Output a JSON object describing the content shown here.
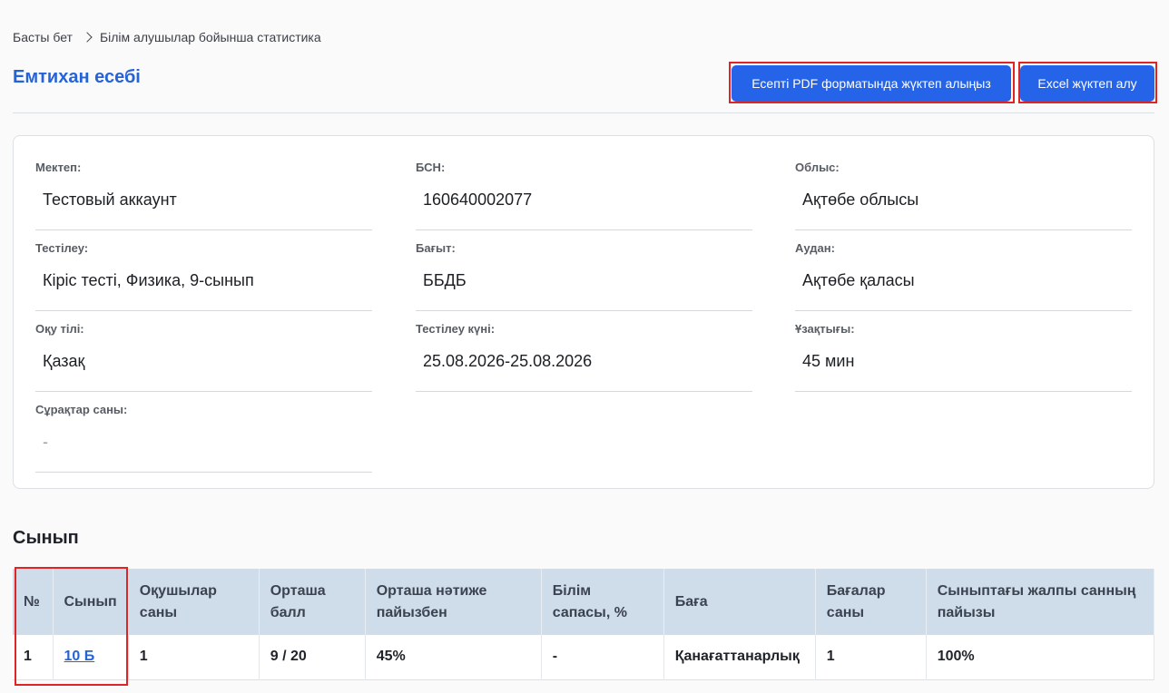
{
  "breadcrumb": {
    "home": "Басты бет",
    "current": "Білім алушылар бойынша статистика"
  },
  "page_title": "Емтихан есебі",
  "actions": {
    "pdf": "Есепті PDF форматында жүктеп алыңыз",
    "excel": "Excel жүктеп алу"
  },
  "info": {
    "school_label": "Мектеп:",
    "school": "Тестовый аккаунт",
    "bin_label": "БСН:",
    "bin": "160640002077",
    "region_label": "Облыс:",
    "region": "Ақтөбе облысы",
    "test_label": "Тестілеу:",
    "test": "Кіріс тесті, Физика, 9-сынып",
    "direction_label": "Бағыт:",
    "direction": "ББДБ",
    "district_label": "Аудан:",
    "district": "Ақтөбе қаласы",
    "lang_label": "Оқу тілі:",
    "lang": "Қазақ",
    "date_label": "Тестілеу күні:",
    "date": "25.08.2026-25.08.2026",
    "duration_label": "Ұзақтығы:",
    "duration": "45 мин",
    "questions_label": "Сұрақтар саны:",
    "questions": "-"
  },
  "section_title": "Сынып",
  "table": {
    "headers": [
      "№",
      "Сынып",
      "Оқушылар саны",
      "Орташа балл",
      "Орташа нәтиже пайызбен",
      "Білім сапасы, %",
      "Баға",
      "Бағалар саны",
      "Сыныптағы жалпы санның пайызы"
    ],
    "rows": [
      [
        "1",
        "10 Б",
        "1",
        "9 / 20",
        "45%",
        "-",
        "Қанағаттанарлық",
        "1",
        "100%"
      ]
    ]
  },
  "colors": {
    "accent": "#2563e8",
    "highlight": "#e02424",
    "table_header": "#cfdcea"
  }
}
